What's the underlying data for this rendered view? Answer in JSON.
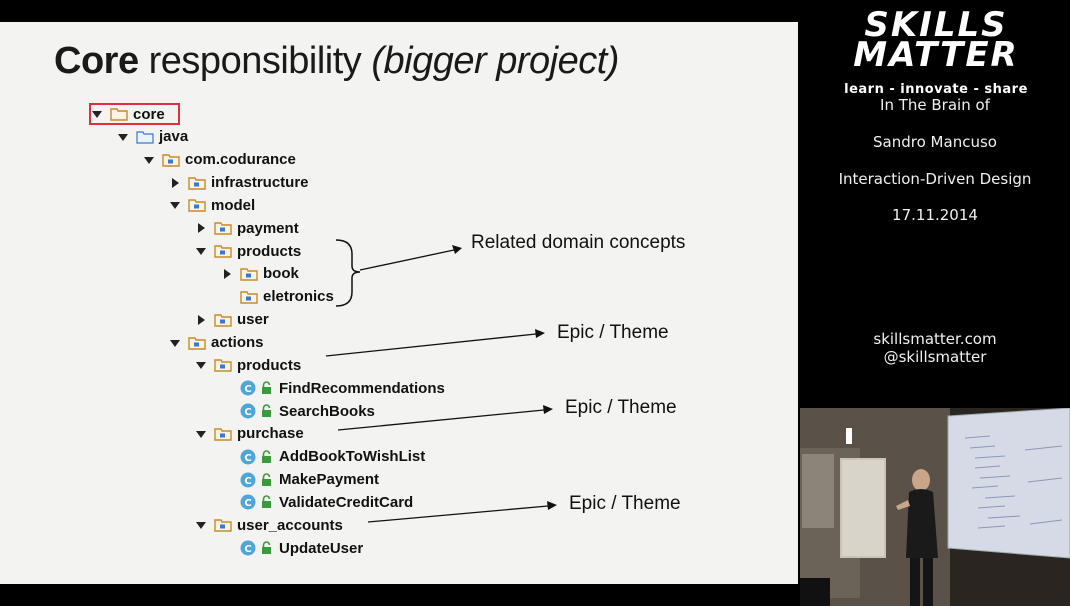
{
  "slide": {
    "title_bold": "Core",
    "title_normal": "responsibility",
    "title_italic": "(bigger project)",
    "tree": [
      {
        "label": "core",
        "type": "folder-plain",
        "expander": "open",
        "name": "tree-node-core"
      },
      {
        "label": "java",
        "type": "folder-source",
        "expander": "open",
        "name": "tree-node-java"
      },
      {
        "label": "com.codurance",
        "type": "package",
        "expander": "open",
        "name": "tree-node-com-codurance"
      },
      {
        "label": "infrastructure",
        "type": "package",
        "expander": "closed",
        "name": "tree-node-infrastructure"
      },
      {
        "label": "model",
        "type": "package",
        "expander": "open",
        "name": "tree-node-model"
      },
      {
        "label": "payment",
        "type": "package",
        "expander": "closed",
        "name": "tree-node-payment"
      },
      {
        "label": "products",
        "type": "package",
        "expander": "open",
        "name": "tree-node-model-products"
      },
      {
        "label": "book",
        "type": "package",
        "expander": "closed",
        "name": "tree-node-book"
      },
      {
        "label": "eletronics",
        "type": "package",
        "expander": "none",
        "name": "tree-node-eletronics"
      },
      {
        "label": "user",
        "type": "package",
        "expander": "closed",
        "name": "tree-node-user"
      },
      {
        "label": "actions",
        "type": "package",
        "expander": "open",
        "name": "tree-node-actions"
      },
      {
        "label": "products",
        "type": "package",
        "expander": "open",
        "name": "tree-node-actions-products"
      },
      {
        "label": "FindRecommendations",
        "type": "class",
        "expander": "none",
        "name": "tree-node-find-recommendations"
      },
      {
        "label": "SearchBooks",
        "type": "class",
        "expander": "none",
        "name": "tree-node-search-books"
      },
      {
        "label": "purchase",
        "type": "package",
        "expander": "open",
        "name": "tree-node-purchase"
      },
      {
        "label": "AddBookToWishList",
        "type": "class",
        "expander": "none",
        "name": "tree-node-add-book-to-wishlist"
      },
      {
        "label": "MakePayment",
        "type": "class",
        "expander": "none",
        "name": "tree-node-make-payment"
      },
      {
        "label": "ValidateCreditCard",
        "type": "class",
        "expander": "none",
        "name": "tree-node-validate-credit-card"
      },
      {
        "label": "user_accounts",
        "type": "package",
        "expander": "open",
        "name": "tree-node-user-accounts"
      },
      {
        "label": "UpdateUser",
        "type": "class",
        "expander": "none",
        "name": "tree-node-update-user"
      }
    ],
    "annotations": {
      "related": "Related domain concepts",
      "epic1": "Epic / Theme",
      "epic2": "Epic / Theme",
      "epic3": "Epic / Theme"
    },
    "colors": {
      "folder": "#c98a2a",
      "package_dot": "#3a78c8",
      "class_circle": "#4fa6d8",
      "lock_green": "#3b9a3b",
      "highlight_box": "#e03040"
    }
  },
  "sidebar": {
    "logo_line1": "SKILLS",
    "logo_line2": "MATTER",
    "tagline": "learn - innovate - share",
    "event_series": "In The Brain of",
    "speaker": "Sandro Mancuso",
    "talk_title": "Interaction-Driven Design",
    "date": "17.11.2014",
    "website": "skillsmatter.com",
    "handle": "@skillsmatter"
  },
  "video": {
    "description_icon": "presenter-video-icon"
  }
}
